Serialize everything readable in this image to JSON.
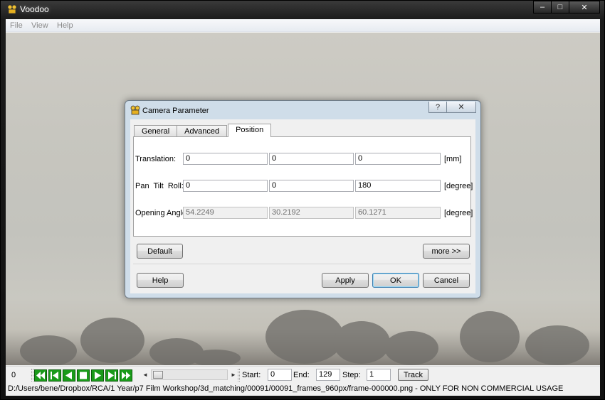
{
  "window": {
    "title": "Voodoo",
    "minimize": "–",
    "maximize": "□",
    "close": "✕"
  },
  "menu": {
    "items": [
      "File",
      "View",
      "Help"
    ]
  },
  "dialog": {
    "title": "Camera Parameter",
    "help_glyph": "?",
    "close_glyph": "✕",
    "tabs": [
      "General",
      "Advanced",
      "Position"
    ],
    "active_tab": "Position",
    "rows": [
      {
        "label": "Translation:",
        "values": [
          "0",
          "0",
          "0"
        ],
        "unit": "[mm]"
      },
      {
        "label": "Pan  Tilt  Roll:",
        "values": [
          "0",
          "0",
          "180"
        ],
        "unit": "[degree]"
      },
      {
        "label": "Opening Angle:",
        "values": [
          "54.2249",
          "30.2192",
          "60.1271"
        ],
        "unit": "[degree]"
      }
    ],
    "buttons": {
      "default": "Default",
      "more": "more >>",
      "help": "Help",
      "apply": "Apply",
      "ok": "OK",
      "cancel": "Cancel"
    }
  },
  "toolbar": {
    "frame": "0",
    "start_label": "Start:",
    "start_value": "0",
    "end_label": "End:",
    "end_value": "129",
    "step_label": "Step:",
    "step_value": "1",
    "track_label": "Track",
    "scroll_left": "◄",
    "scroll_right": "►",
    "accent": "#1a9a1a"
  },
  "status": {
    "text": "D:/Users/bene/Dropbox/RCA/1 Year/p7 Film Workshop/3d_matching/00091/00091_frames_960px/frame-000000.png - ONLY FOR NON COMMERCIAL USAGE"
  }
}
